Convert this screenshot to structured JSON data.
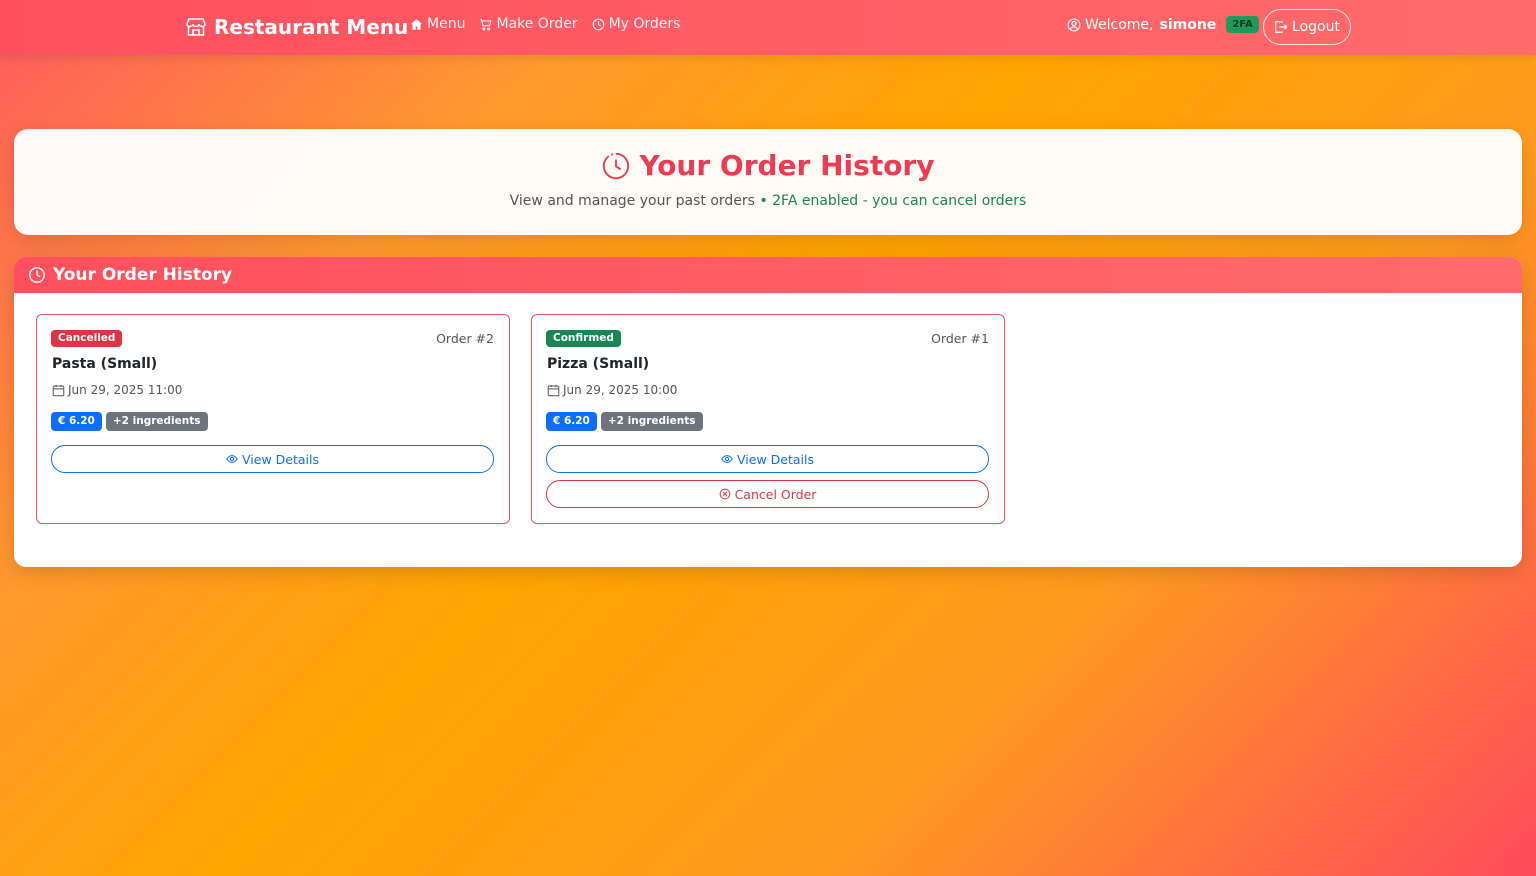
{
  "navbar": {
    "brand": "Restaurant Menu",
    "links": [
      {
        "label": "Menu",
        "icon": "house-icon"
      },
      {
        "label": "Make Order",
        "icon": "cart-icon"
      },
      {
        "label": "My Orders",
        "icon": "clock-icon"
      }
    ],
    "welcome_prefix": "Welcome,",
    "username": "simone",
    "twofa_badge": "2FA",
    "logout_label": "Logout"
  },
  "hero": {
    "title": "Your Order History",
    "subtitle": "View and manage your past orders",
    "twofa_note": "• 2FA enabled - you can cancel orders"
  },
  "panel": {
    "title": "Your Order History"
  },
  "orders": [
    {
      "status": "Cancelled",
      "order_label": "Order #2",
      "item": "Pasta (Small)",
      "date": "Jun 29, 2025 11:00",
      "price": "€  6.20",
      "ingredients": "+2 ingredients",
      "view_label": "View Details"
    },
    {
      "status": "Confirmed",
      "order_label": "Order #1",
      "item": "Pizza (Small)",
      "date": "Jun 29, 2025 10:00",
      "price": "€  6.20",
      "ingredients": "+2 ingredients",
      "view_label": "View Details",
      "cancel_label": "Cancel Order"
    }
  ],
  "colors": {
    "brand_red": "#ec3b53",
    "cancelled": "#dc3545",
    "confirmed": "#198754",
    "primary": "#0d6efd",
    "secondary": "#6c757d"
  }
}
